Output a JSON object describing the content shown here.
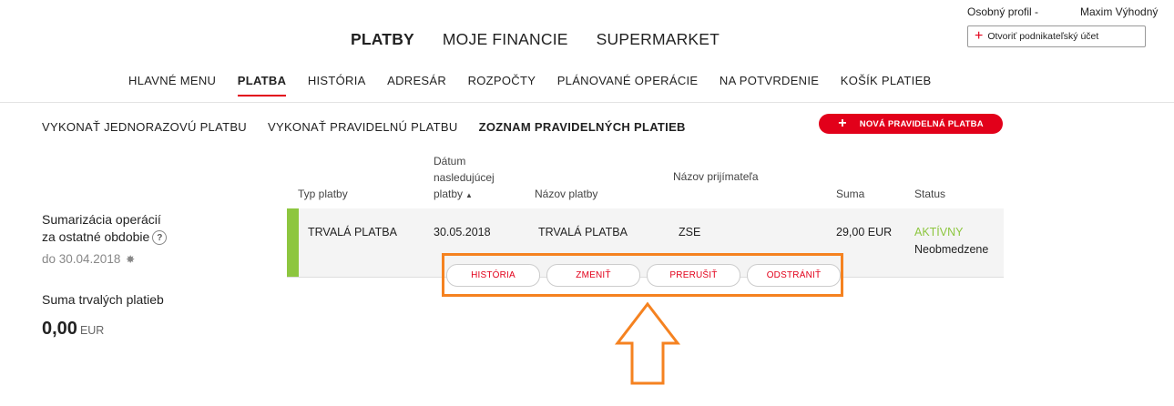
{
  "profile": {
    "label": "Osobný profil -",
    "name": "Maxim Výhodný",
    "open_account": "Otvoriť podnikateľský účet"
  },
  "top_nav": {
    "items": [
      "PLATBY",
      "MOJE FINANCIE",
      "SUPERMARKET"
    ],
    "active": "PLATBY"
  },
  "sub_nav": {
    "items": [
      "HLAVNÉ MENU",
      "PLATBA",
      "HISTÓRIA",
      "ADRESÁR",
      "ROZPOČTY",
      "PLÁNOVANÉ OPERÁCIE",
      "NA POTVRDENIE",
      "KOŠÍK PLATIEB"
    ],
    "active": "PLATBA"
  },
  "payment_tabs": {
    "items": [
      "VYKONAŤ JEDNORAZOVÚ PLATBU",
      "VYKONAŤ PRAVIDELNÚ PLATBU",
      "ZOZNAM PRAVIDELNÝCH PLATIEB"
    ],
    "active": "ZOZNAM PRAVIDELNÝCH PLATIEB"
  },
  "new_button": "NOVÁ PRAVIDELNÁ PLATBA",
  "summary": {
    "title_line1": "Sumarizácia operácií",
    "title_line2": "za ostatné obdobie",
    "help": "?",
    "until": "do 30.04.2018",
    "total_label": "Suma trvalých platieb",
    "total_value": "0,00",
    "currency": "EUR"
  },
  "table": {
    "headers": {
      "type": "Typ platby",
      "date_l1": "Dátum",
      "date_l2": "nasledujúcej",
      "date_l3": "platby",
      "name": "Názov platby",
      "recipient": "Názov prijímateľa",
      "amount": "Suma",
      "status": "Status"
    },
    "rows": [
      {
        "type": "TRVALÁ PLATBA",
        "date": "30.05.2018",
        "name": "TRVALÁ PLATBA",
        "recipient": "ZSE",
        "amount": "29,00 EUR",
        "status": "AKTÍVNY",
        "status_note": "Neobmedzene"
      }
    ]
  },
  "actions": [
    "HISTÓRIA",
    "ZMENIŤ",
    "PRERUŠIŤ",
    "ODSTRÁNIŤ"
  ],
  "colors": {
    "brand": "#e2001a",
    "active_status": "#8dc63f",
    "highlight": "#f58220"
  }
}
